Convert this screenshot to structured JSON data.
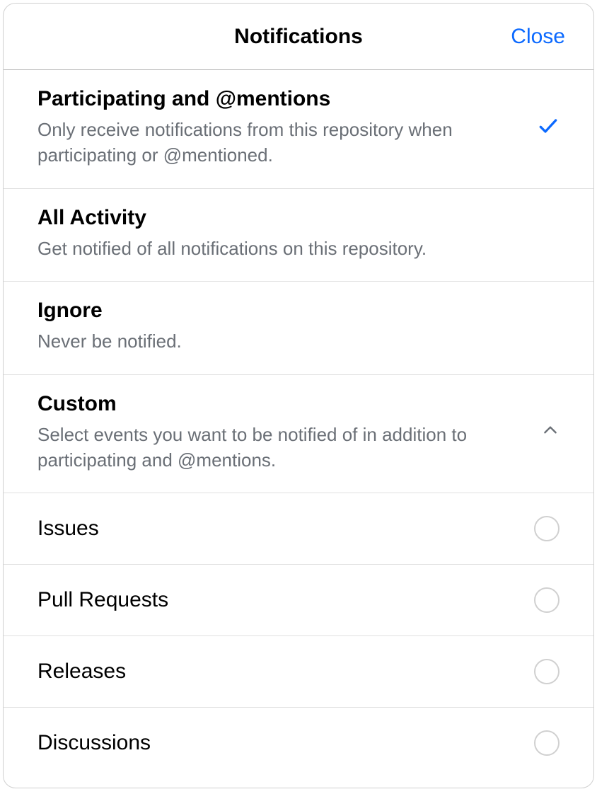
{
  "header": {
    "title": "Notifications",
    "close_label": "Close"
  },
  "options": {
    "participating": {
      "title": "Participating and @mentions",
      "description": "Only receive notifications from this repository when participating or @mentioned.",
      "selected": true
    },
    "all_activity": {
      "title": "All Activity",
      "description": "Get notified of all notifications on this repository."
    },
    "ignore": {
      "title": "Ignore",
      "description": "Never be notified."
    },
    "custom": {
      "title": "Custom",
      "description": "Select events you want to be notified of in addition to participating and @mentions.",
      "expanded": true
    }
  },
  "custom_items": [
    {
      "label": "Issues",
      "checked": false
    },
    {
      "label": "Pull Requests",
      "checked": false
    },
    {
      "label": "Releases",
      "checked": false
    },
    {
      "label": "Discussions",
      "checked": false
    }
  ]
}
